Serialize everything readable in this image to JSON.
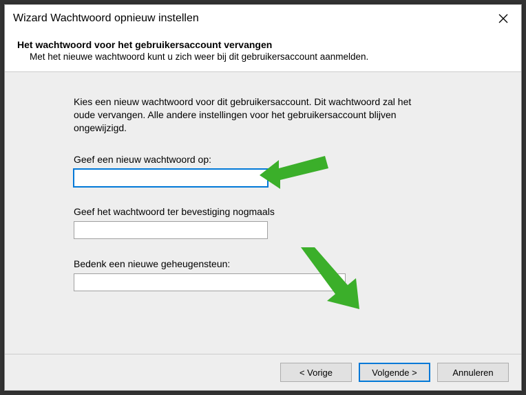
{
  "titlebar": {
    "title": "Wizard Wachtwoord opnieuw instellen"
  },
  "header": {
    "headline": "Het wachtwoord voor het gebruikersaccount vervangen",
    "sub": "Met het nieuwe wachtwoord kunt u zich weer bij dit gebruikersaccount aanmelden."
  },
  "body": {
    "instruction": "Kies een nieuw wachtwoord voor dit gebruikersaccount. Dit wachtwoord zal het oude vervangen. Alle andere instellingen voor het gebruikersaccount blijven ongewijzigd.",
    "password_label": "Geef een nieuw wachtwoord op:",
    "password_value": "",
    "confirm_label": "Geef het wachtwoord ter bevestiging nogmaals",
    "confirm_value": "",
    "hint_label": "Bedenk een nieuwe geheugensteun:",
    "hint_value": ""
  },
  "footer": {
    "back": "< Vorige",
    "next": "Volgende >",
    "cancel": "Annuleren"
  }
}
